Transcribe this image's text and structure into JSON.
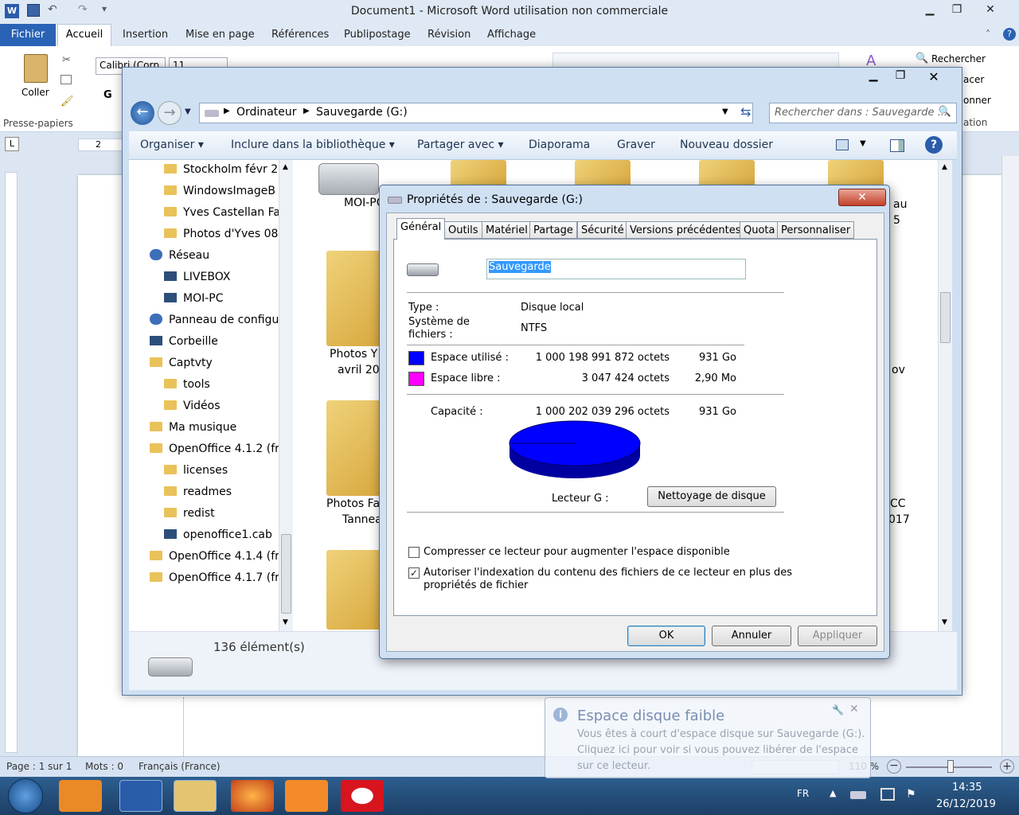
{
  "word": {
    "title": "Document1  -  Microsoft Word utilisation non commerciale",
    "tabs": [
      "Fichier",
      "Accueil",
      "Insertion",
      "Mise en page",
      "Références",
      "Publipostage",
      "Révision",
      "Affichage"
    ],
    "font_name": "Calibri (Corp",
    "font_size": "11",
    "paste_label": "Coller",
    "bold_label": "G",
    "group_clipboard": "Presse-papiers",
    "search_label": "Rechercher",
    "replace_label": "acer",
    "select_label": "onner",
    "editing_label": "ation",
    "ruler_number": "2",
    "status": {
      "page": "Page : 1 sur 1",
      "words": "Mots : 0",
      "lang": "Français (France)",
      "zoom": "110 %"
    }
  },
  "explorer": {
    "path": [
      "Ordinateur",
      "Sauvegarde (G:)"
    ],
    "search_placeholder": "Rechercher dans : Sauvegarde ...",
    "toolbar": [
      "Organiser",
      "Inclure dans la bibliothèque",
      "Partager avec",
      "Diaporama",
      "Graver",
      "Nouveau dossier"
    ],
    "nav_items": [
      {
        "label": "Stockholm févr 2",
        "icon": "folder-icon",
        "indent": 1
      },
      {
        "label": "WindowsImageB",
        "icon": "folder-icon",
        "indent": 1
      },
      {
        "label": "Yves Castellan Fa",
        "icon": "folder-icon",
        "indent": 1
      },
      {
        "label": "Photos d'Yves 08",
        "icon": "folder-icon",
        "indent": 1
      },
      {
        "label": "Réseau",
        "icon": "network-icon",
        "indent": 0
      },
      {
        "label": "LIVEBOX",
        "icon": "computer-icon",
        "indent": 1
      },
      {
        "label": "MOI-PC",
        "icon": "computer-icon",
        "indent": 1
      },
      {
        "label": "Panneau de configu",
        "icon": "control-panel-icon",
        "indent": 0
      },
      {
        "label": "Corbeille",
        "icon": "recycle-bin-icon",
        "indent": 0
      },
      {
        "label": "Captvty",
        "icon": "folder-icon",
        "indent": 0
      },
      {
        "label": "tools",
        "icon": "folder-icon",
        "indent": 1
      },
      {
        "label": "Vidéos",
        "icon": "folder-icon",
        "indent": 1
      },
      {
        "label": "Ma musique",
        "icon": "folder-icon",
        "indent": 0
      },
      {
        "label": "OpenOffice 4.1.2 (fr",
        "icon": "folder-icon",
        "indent": 0
      },
      {
        "label": "licenses",
        "icon": "folder-icon",
        "indent": 1
      },
      {
        "label": "readmes",
        "icon": "folder-icon",
        "indent": 1
      },
      {
        "label": "redist",
        "icon": "folder-icon",
        "indent": 1
      },
      {
        "label": "openoffice1.cab",
        "icon": "file-icon",
        "indent": 1
      },
      {
        "label": "OpenOffice 4.1.4 (fr",
        "icon": "folder-icon",
        "indent": 0
      },
      {
        "label": "OpenOffice 4.1.7 (fr",
        "icon": "folder-icon",
        "indent": 0
      }
    ],
    "content_labels": {
      "moi_pc": "MOI-PC",
      "photos_y_1": "Photos  Y",
      "photos_y_2": "avril 20",
      "photos_f_1": "Photos Fa",
      "photos_f_2": "Tannea",
      "right_au": "au",
      "right_5": "5",
      "right_ov": "ov",
      "right_cc": "CC",
      "right_017": "017"
    },
    "item_count": "136 élément(s)"
  },
  "dialog": {
    "title": "Propriétés de : Sauvegarde (G:)",
    "tabs": [
      "Général",
      "Outils",
      "Matériel",
      "Partage",
      "Sécurité",
      "Versions précédentes",
      "Quota",
      "Personnaliser"
    ],
    "volume_name": "Sauvegarde",
    "type_label": "Type :",
    "type_value": "Disque local",
    "fs_label_1": "Système de",
    "fs_label_2": "fichiers :",
    "fs_value": "NTFS",
    "used_label": "Espace utilisé :",
    "used_bytes": "1 000 198 991 872 octets",
    "used_size": "931 Go",
    "free_label": "Espace libre :",
    "free_bytes": "3 047 424 octets",
    "free_size": "2,90 Mo",
    "capacity_label": "Capacité :",
    "capacity_bytes": "1 000 202 039 296 octets",
    "capacity_size": "931 Go",
    "drive_label": "Lecteur G :",
    "cleanup_button": "Nettoyage de disque",
    "compress_label": "Compresser ce lecteur pour augmenter l'espace disponible",
    "index_label_1": "Autoriser l'indexation du contenu des fichiers de ce lecteur en plus des",
    "index_label_2": "propriétés de fichier",
    "compress_checked": false,
    "index_checked": true,
    "ok": "OK",
    "cancel": "Annuler",
    "apply": "Appliquer",
    "used_fraction": 0.999997,
    "colors": {
      "used": "#0000ff",
      "free": "#ff00ff"
    }
  },
  "toast": {
    "title": "Espace disque faible",
    "line1": "Vous êtes à court d'espace disque sur Sauvegarde (G:).",
    "line2": "Cliquez ici pour voir si vous pouvez libérer de l'espace",
    "line3": "sur ce lecteur."
  },
  "taskbar": {
    "lang": "FR",
    "time": "14:35",
    "date": "26/12/2019"
  }
}
